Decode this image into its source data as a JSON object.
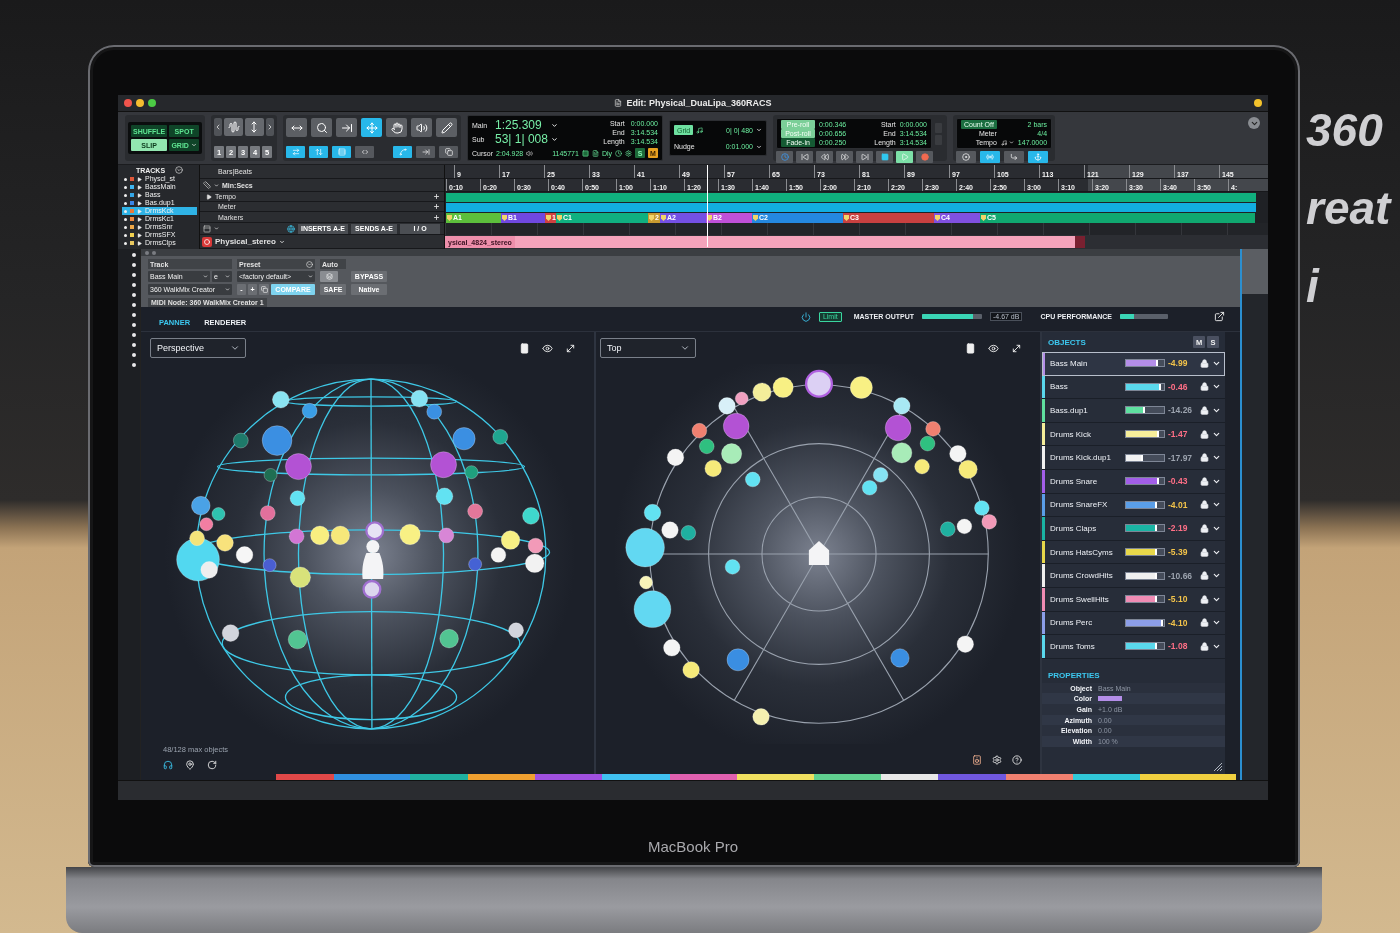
{
  "scene": {
    "laptop_label": "MacBook Pro",
    "sign_lines": [
      "360",
      "reat",
      "i"
    ]
  },
  "window": {
    "title": "Edit: Physical_DuaLipa_360RACS"
  },
  "toolbar": {
    "edit_modes": [
      {
        "label": "SHUFFLE",
        "selected": false,
        "menu": false
      },
      {
        "label": "SPOT",
        "selected": false,
        "menu": false
      },
      {
        "label": "SLIP",
        "selected": true,
        "menu": false
      },
      {
        "label": "GRID",
        "selected": false,
        "menu": true
      }
    ],
    "zoom_presets": [
      "1",
      "2",
      "3",
      "4",
      "5"
    ],
    "tools": [
      {
        "selected": false
      },
      {
        "selected": false
      },
      {
        "selected": false
      },
      {
        "selected": true
      },
      {
        "selected": false
      },
      {
        "selected": false
      },
      {
        "selected": false
      }
    ],
    "toggles": [
      {
        "on": true
      },
      {
        "on": true
      },
      {
        "on": true
      },
      {
        "on": false
      },
      {
        "on": true
      },
      {
        "on": false
      },
      {
        "on": false
      }
    ],
    "counter": {
      "main_label": "Main",
      "main": "1:25.309",
      "sub_label": "Sub",
      "sub": "53| 1| 008",
      "selection": [
        {
          "label": "Start",
          "value": "0:00.000"
        },
        {
          "label": "End",
          "value": "3:14.534"
        },
        {
          "label": "Length",
          "value": "3:14.534"
        }
      ],
      "cursor_label": "Cursor",
      "cursor": "2:04.928",
      "sample": "1145771",
      "dly": "Dly",
      "s": "S",
      "m": "M"
    },
    "grid": {
      "label": "Grid",
      "value": "0| 0| 480",
      "nudge_label": "Nudge",
      "nudge": "0:01.000"
    },
    "rolls": [
      {
        "label": "Pre-roll",
        "value": "0:00.346",
        "on": false
      },
      {
        "label": "Post-roll",
        "value": "0:00.656",
        "on": false
      },
      {
        "label": "Fade-in",
        "value": "0:00.250",
        "on": true
      }
    ],
    "selection": [
      {
        "label": "Start",
        "value": "0:00.000"
      },
      {
        "label": "End",
        "value": "3:14.534"
      },
      {
        "label": "Length",
        "value": "3:14.534"
      }
    ],
    "transport": [
      {
        "on": false
      },
      {
        "on": false
      },
      {
        "on": false
      },
      {
        "on": false
      },
      {
        "on": false
      },
      {
        "on": false
      },
      {
        "on": true
      },
      {
        "on": false
      }
    ],
    "tempo": {
      "count_off": "Count Off",
      "count_off_value": "2 bars",
      "meter_label": "Meter",
      "meter": "4/4",
      "tempo_label": "Tempo",
      "tempo": "147.0000"
    },
    "midi_buttons": [
      {
        "on": false
      },
      {
        "on": true
      },
      {
        "on": false
      },
      {
        "on": true
      }
    ]
  },
  "tracks_panel": {
    "title": "TRACKS",
    "tracks": [
      {
        "name": "Physcl_st",
        "color": "#e0583a",
        "selected": false
      },
      {
        "name": "BassMain",
        "color": "#3fb4f0",
        "selected": false
      },
      {
        "name": "Bass",
        "color": "#33a6e8",
        "selected": false
      },
      {
        "name": "Bas.dup1",
        "color": "#3a86e8",
        "selected": false
      },
      {
        "name": "DrmsKck",
        "color": "#e87a3a",
        "selected": true
      },
      {
        "name": "DrmsKc1",
        "color": "#f08a40",
        "selected": false
      },
      {
        "name": "DrmsSnr",
        "color": "#f0a848",
        "selected": false
      },
      {
        "name": "DrmsSFX",
        "color": "#f0d050",
        "selected": false
      },
      {
        "name": "DrmsClps",
        "color": "#e8c860",
        "selected": false
      }
    ]
  },
  "rulers": {
    "rows": [
      {
        "label": "Bars|Beats",
        "kind": "bars"
      },
      {
        "label": "Min:Secs",
        "kind": "minsecs"
      },
      {
        "label": "Tempo",
        "kind": "tempo"
      },
      {
        "label": "Meter",
        "kind": "meter"
      },
      {
        "label": "Markers",
        "kind": "markers"
      }
    ],
    "bars": [
      "9",
      "17",
      "25",
      "33",
      "41",
      "49",
      "57",
      "65",
      "73",
      "81",
      "89",
      "97",
      "105",
      "113",
      "121",
      "129",
      "137",
      "145"
    ],
    "minsecs": [
      "0:10",
      "0:20",
      "0:30",
      "0:40",
      "0:50",
      "1:00",
      "1:10",
      "1:20",
      "1:30",
      "1:40",
      "1:50",
      "2:00",
      "2:10",
      "2:20",
      "2:30",
      "2:40",
      "2:50",
      "3:00",
      "3:10",
      "3:20",
      "3:30",
      "3:40",
      "3:50",
      "4:"
    ],
    "markers": [
      {
        "label": "A1",
        "color": "#5cbf3c"
      },
      {
        "label": "B1",
        "color": "#7048e0"
      },
      {
        "label": "1",
        "color": "#d04040"
      },
      {
        "label": "C1",
        "color": "#10b080"
      },
      {
        "label": "2",
        "color": "#c89a30"
      },
      {
        "label": "A2",
        "color": "#7450e4"
      },
      {
        "label": "B2",
        "color": "#c050d8"
      },
      {
        "label": "C2",
        "color": "#2488e0"
      },
      {
        "label": "C3",
        "color": "#c84040"
      },
      {
        "label": "C4",
        "color": "#8050e0"
      },
      {
        "label": "C5",
        "color": "#10a870"
      }
    ]
  },
  "track": {
    "inserts": "INSERTS A-E",
    "sends": "SENDS A-E",
    "io": "I / O",
    "name": "Physical_stereo",
    "clip": "ysical_4824_stereo"
  },
  "plugin": {
    "track_label": "Track",
    "preset_label": "Preset",
    "auto_label": "Auto",
    "track": "Bass Main",
    "channel": "e",
    "preset": "<factory default>",
    "insert": "360 WalkMix Creator",
    "minus": "-",
    "plus": "+",
    "compare": "COMPARE",
    "bypass": "BYPASS",
    "safe": "SAFE",
    "native": "Native",
    "midi_node": "MIDI Node: 360 WalkMix Creator 1"
  },
  "walkmix": {
    "tabs": [
      {
        "label": "PANNER",
        "selected": true
      },
      {
        "label": "RENDERER",
        "selected": false
      }
    ],
    "power_on": true,
    "limit": {
      "label": "Limit",
      "on": true
    },
    "master_label": "MASTER OUTPUT",
    "master_meter": {
      "level": 0.85
    },
    "master_reading": "-4.67 dB",
    "cpu_label": "CPU PERFORMANCE",
    "cpu_meter": {
      "level": 0.3
    }
  },
  "views": [
    {
      "mode": "Perspective",
      "kind": "sphere",
      "footer": "48/128 max objects"
    },
    {
      "mode": "Top",
      "kind": "top"
    }
  ],
  "objects": {
    "title": "OBJECTS",
    "mute": "M",
    "solo": "S",
    "items": [
      {
        "name": "Bass Main",
        "color": "#b48ee8",
        "level": 0.84,
        "reading": {
          "text": "-4.99",
          "color": "#f4c44a"
        },
        "selected": true
      },
      {
        "name": "Bass",
        "color": "#5ad8ec",
        "level": 0.92,
        "reading": {
          "text": "-0.46",
          "color": "#ff6f86"
        },
        "selected": false
      },
      {
        "name": "Bass.dup1",
        "color": "#5fe0a0",
        "level": 0.5,
        "reading": {
          "text": "-14.26",
          "color": "#9ca3ae"
        },
        "selected": false
      },
      {
        "name": "Drums Kick",
        "color": "#f6ee9a",
        "level": 0.86,
        "reading": {
          "text": "-1.47",
          "color": "#ff6f86"
        },
        "selected": false
      },
      {
        "name": "Drums Kick.dup1",
        "color": "#f2f2f2",
        "level": 0.45,
        "reading": {
          "text": "-17.97",
          "color": "#9ca3ae"
        },
        "selected": false
      },
      {
        "name": "Drums Snare",
        "color": "#a25ee8",
        "level": 0.86,
        "reading": {
          "text": "-0.43",
          "color": "#ff6f86"
        },
        "selected": false
      },
      {
        "name": "Drums SnareFX",
        "color": "#5a9ee8",
        "level": 0.82,
        "reading": {
          "text": "-4.01",
          "color": "#f4c44a"
        },
        "selected": false
      },
      {
        "name": "Drums Claps",
        "color": "#1ab4a4",
        "level": 0.82,
        "reading": {
          "text": "-2.19",
          "color": "#ff6f86"
        },
        "selected": false
      },
      {
        "name": "Drums HatsCyms",
        "color": "#e8d84a",
        "level": 0.82,
        "reading": {
          "text": "-5.39",
          "color": "#f4c44a"
        },
        "selected": false
      },
      {
        "name": "Drums CrowdHits",
        "color": "#f0f0f0",
        "level": 0.82,
        "reading": {
          "text": "-10.66",
          "color": "#9ca3ae"
        },
        "selected": false
      },
      {
        "name": "Drums SwellHits",
        "color": "#f08cb4",
        "level": 0.82,
        "reading": {
          "text": "-5.10",
          "color": "#f4c44a"
        },
        "selected": false
      },
      {
        "name": "Drums Perc",
        "color": "#8c9ee8",
        "level": 0.97,
        "reading": {
          "text": "-4.10",
          "color": "#f4c44a"
        },
        "selected": false
      },
      {
        "name": "Drums Toms",
        "color": "#5ad8ec",
        "level": 0.82,
        "reading": {
          "text": "-1.08",
          "color": "#ff6f86"
        },
        "selected": false
      }
    ]
  },
  "properties": {
    "title": "PROPERTIES",
    "rows": [
      {
        "label": "Object",
        "kind": "text",
        "value": "Bass Main"
      },
      {
        "label": "Color",
        "kind": "swatch",
        "color": "#b48ee8"
      },
      {
        "label": "Gain",
        "kind": "text",
        "value": "+1.0 dB"
      },
      {
        "label": "Azimuth",
        "kind": "text",
        "value": "0.00"
      },
      {
        "label": "Elevation",
        "kind": "text",
        "value": "0.00"
      },
      {
        "label": "Width",
        "kind": "text",
        "value": "100 %"
      }
    ]
  }
}
